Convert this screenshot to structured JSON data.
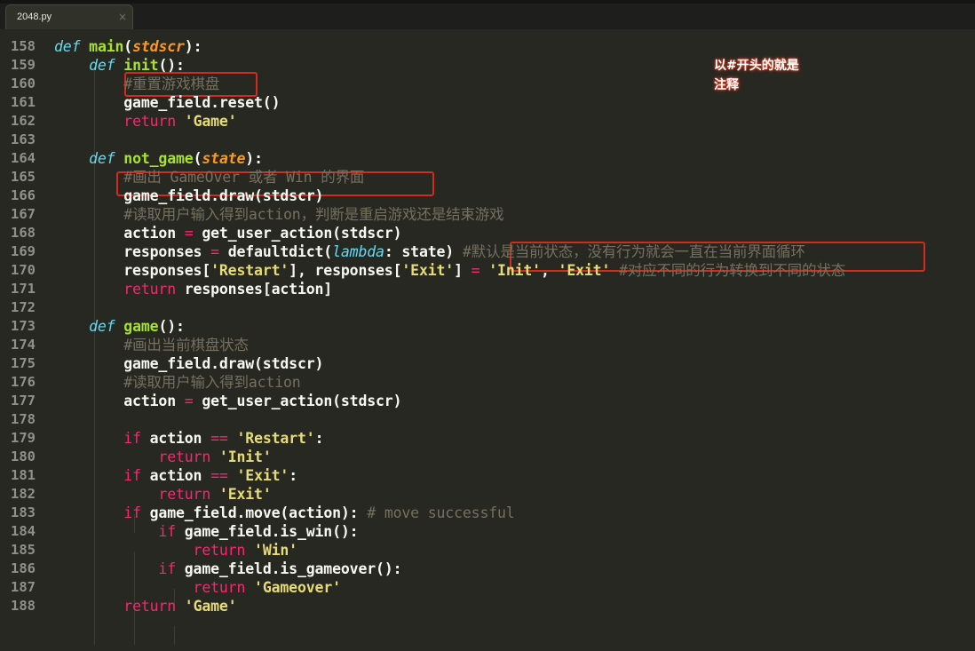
{
  "tab": {
    "title": "2048.py",
    "close_icon": "×"
  },
  "annotation": {
    "line1": "以#开头的就是",
    "line2": "注释"
  },
  "theme": {
    "background": "#272822",
    "keyword": "#66d9ef",
    "string": "#e6db74",
    "function": "#a6e22e",
    "comment": "#75715e",
    "control": "#f92672",
    "annotation_box": "#d22b1f"
  },
  "lines": [
    {
      "n": "158",
      "parts": [
        {
          "c": "kw",
          "t": "def"
        },
        {
          "t": " "
        },
        {
          "c": "fn",
          "t": "main"
        },
        {
          "t": "("
        },
        {
          "c": "param",
          "t": "stdscr"
        },
        {
          "t": "):"
        }
      ]
    },
    {
      "n": "159",
      "parts": [
        {
          "t": "    "
        },
        {
          "c": "kw",
          "t": "def"
        },
        {
          "t": " "
        },
        {
          "c": "fn",
          "t": "init"
        },
        {
          "t": "():"
        }
      ]
    },
    {
      "n": "160",
      "parts": [
        {
          "t": "        "
        },
        {
          "c": "cm",
          "t": "#重置游戏棋盘"
        }
      ]
    },
    {
      "n": "161",
      "parts": [
        {
          "t": "        game_field.reset()"
        }
      ]
    },
    {
      "n": "162",
      "parts": [
        {
          "t": "        "
        },
        {
          "c": "ctrl",
          "t": "return"
        },
        {
          "t": " "
        },
        {
          "c": "str",
          "t": "'Game'"
        }
      ]
    },
    {
      "n": "163",
      "parts": []
    },
    {
      "n": "164",
      "parts": [
        {
          "t": "    "
        },
        {
          "c": "kw",
          "t": "def"
        },
        {
          "t": " "
        },
        {
          "c": "fn",
          "t": "not_game"
        },
        {
          "t": "("
        },
        {
          "c": "param",
          "t": "state"
        },
        {
          "t": "):"
        }
      ]
    },
    {
      "n": "165",
      "parts": [
        {
          "t": "        "
        },
        {
          "c": "cm",
          "t": "#画出 GameOver 或者 Win 的界面"
        }
      ]
    },
    {
      "n": "166",
      "parts": [
        {
          "t": "        game_field.draw(stdscr)"
        }
      ]
    },
    {
      "n": "167",
      "parts": [
        {
          "t": "        "
        },
        {
          "c": "cm",
          "t": "#读取用户输入得到action，判断是重启游戏还是结束游戏"
        }
      ]
    },
    {
      "n": "168",
      "parts": [
        {
          "t": "        action "
        },
        {
          "c": "op",
          "t": "="
        },
        {
          "t": " get_user_action(stdscr)"
        }
      ]
    },
    {
      "n": "169",
      "parts": [
        {
          "t": "        responses "
        },
        {
          "c": "op",
          "t": "="
        },
        {
          "t": " defaultdict("
        },
        {
          "c": "lam",
          "t": "lambda"
        },
        {
          "t": ": state) "
        },
        {
          "c": "cm",
          "t": "#默认是当前状态，没有行为就会一直在当前界面循环"
        }
      ]
    },
    {
      "n": "170",
      "parts": [
        {
          "t": "        responses["
        },
        {
          "c": "str",
          "t": "'Restart'"
        },
        {
          "t": "], responses["
        },
        {
          "c": "str",
          "t": "'Exit'"
        },
        {
          "t": "] "
        },
        {
          "c": "op",
          "t": "="
        },
        {
          "t": " "
        },
        {
          "c": "str",
          "t": "'Init'"
        },
        {
          "t": ", "
        },
        {
          "c": "str",
          "t": "'Exit'"
        },
        {
          "t": " "
        },
        {
          "c": "cm",
          "t": "#对应不同的行为转换到不同的状态"
        }
      ]
    },
    {
      "n": "171",
      "parts": [
        {
          "t": "        "
        },
        {
          "c": "ctrl",
          "t": "return"
        },
        {
          "t": " responses[action]"
        }
      ]
    },
    {
      "n": "172",
      "parts": []
    },
    {
      "n": "173",
      "parts": [
        {
          "t": "    "
        },
        {
          "c": "kw",
          "t": "def"
        },
        {
          "t": " "
        },
        {
          "c": "fn",
          "t": "game"
        },
        {
          "t": "():"
        }
      ]
    },
    {
      "n": "174",
      "parts": [
        {
          "t": "        "
        },
        {
          "c": "cm",
          "t": "#画出当前棋盘状态"
        }
      ]
    },
    {
      "n": "175",
      "parts": [
        {
          "t": "        game_field.draw(stdscr)"
        }
      ]
    },
    {
      "n": "176",
      "parts": [
        {
          "t": "        "
        },
        {
          "c": "cm",
          "t": "#读取用户输入得到action"
        }
      ]
    },
    {
      "n": "177",
      "parts": [
        {
          "t": "        action "
        },
        {
          "c": "op",
          "t": "="
        },
        {
          "t": " get_user_action(stdscr)"
        }
      ]
    },
    {
      "n": "178",
      "parts": []
    },
    {
      "n": "179",
      "parts": [
        {
          "t": "        "
        },
        {
          "c": "ctrl",
          "t": "if"
        },
        {
          "t": " action "
        },
        {
          "c": "op",
          "t": "=="
        },
        {
          "t": " "
        },
        {
          "c": "str",
          "t": "'Restart'"
        },
        {
          "t": ":"
        }
      ]
    },
    {
      "n": "180",
      "parts": [
        {
          "t": "            "
        },
        {
          "c": "ctrl",
          "t": "return"
        },
        {
          "t": " "
        },
        {
          "c": "str",
          "t": "'Init'"
        }
      ]
    },
    {
      "n": "181",
      "parts": [
        {
          "t": "        "
        },
        {
          "c": "ctrl",
          "t": "if"
        },
        {
          "t": " action "
        },
        {
          "c": "op",
          "t": "=="
        },
        {
          "t": " "
        },
        {
          "c": "str",
          "t": "'Exit'"
        },
        {
          "t": ":"
        }
      ]
    },
    {
      "n": "182",
      "parts": [
        {
          "t": "            "
        },
        {
          "c": "ctrl",
          "t": "return"
        },
        {
          "t": " "
        },
        {
          "c": "str",
          "t": "'Exit'"
        }
      ]
    },
    {
      "n": "183",
      "parts": [
        {
          "t": "        "
        },
        {
          "c": "ctrl",
          "t": "if"
        },
        {
          "t": " game_field.move(action): "
        },
        {
          "c": "cm",
          "t": "# move successful"
        }
      ]
    },
    {
      "n": "184",
      "parts": [
        {
          "t": "            "
        },
        {
          "c": "ctrl",
          "t": "if"
        },
        {
          "t": " game_field.is_win():"
        }
      ]
    },
    {
      "n": "185",
      "parts": [
        {
          "t": "                "
        },
        {
          "c": "ctrl",
          "t": "return"
        },
        {
          "t": " "
        },
        {
          "c": "str",
          "t": "'Win'"
        }
      ]
    },
    {
      "n": "186",
      "parts": [
        {
          "t": "            "
        },
        {
          "c": "ctrl",
          "t": "if"
        },
        {
          "t": " game_field.is_gameover():"
        }
      ]
    },
    {
      "n": "187",
      "parts": [
        {
          "t": "                "
        },
        {
          "c": "ctrl",
          "t": "return"
        },
        {
          "t": " "
        },
        {
          "c": "str",
          "t": "'Gameover'"
        }
      ]
    },
    {
      "n": "188",
      "parts": [
        {
          "t": "        "
        },
        {
          "c": "ctrl",
          "t": "return"
        },
        {
          "t": " "
        },
        {
          "c": "str",
          "t": "'Game'"
        }
      ]
    }
  ]
}
